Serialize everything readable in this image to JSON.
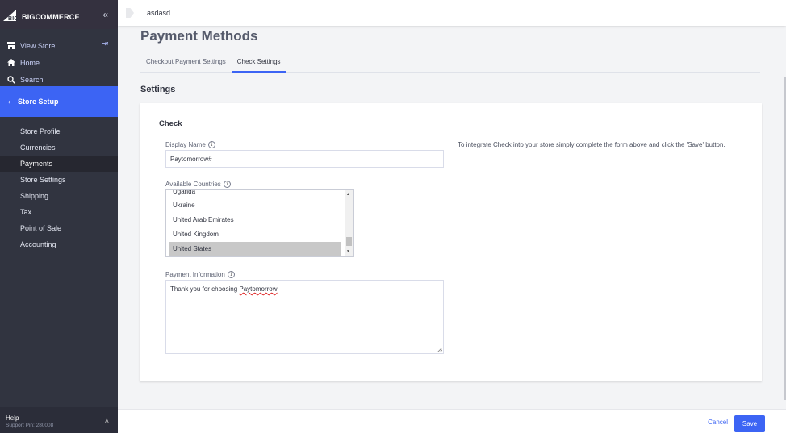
{
  "sidebar": {
    "logo": "BIGCOMMERCE",
    "nav": [
      {
        "label": "View Store",
        "icon": "storefront-icon"
      },
      {
        "label": "Home",
        "icon": "home-icon"
      },
      {
        "label": "Search",
        "icon": "search-icon"
      }
    ],
    "section": "Store Setup",
    "items": [
      {
        "label": "Store Profile"
      },
      {
        "label": "Currencies"
      },
      {
        "label": "Payments"
      },
      {
        "label": "Store Settings"
      },
      {
        "label": "Shipping"
      },
      {
        "label": "Tax"
      },
      {
        "label": "Point of Sale"
      },
      {
        "label": "Accounting"
      }
    ],
    "help": {
      "label": "Help",
      "pin": "Support Pin: 280008"
    }
  },
  "topbar": {
    "store_name": "asdasd"
  },
  "main": {
    "title": "Payment Methods",
    "tabs": [
      {
        "label": "Checkout Payment Settings"
      },
      {
        "label": "Check Settings"
      }
    ],
    "active_tab": "Check Settings",
    "settings_heading": "Settings",
    "card": {
      "title": "Check",
      "display_name": {
        "label": "Display Name",
        "value": "Paytomorrow#"
      },
      "help_text": "To integrate Check into your store simply complete the form above and click the 'Save' button.",
      "countries": {
        "label": "Available Countries",
        "options": [
          "Uganda",
          "Ukraine",
          "United Arab Emirates",
          "United Kingdom",
          "United States"
        ],
        "selected": "United States"
      },
      "payment_info": {
        "label": "Payment Information",
        "value_prefix": "Thank you for choosing ",
        "value_word": "Paytomorrow"
      }
    }
  },
  "footer": {
    "cancel": "Cancel",
    "save": "Save"
  },
  "colors": {
    "sidebar": "#313440",
    "accent": "#3c64f4",
    "active_item": "#262730"
  }
}
